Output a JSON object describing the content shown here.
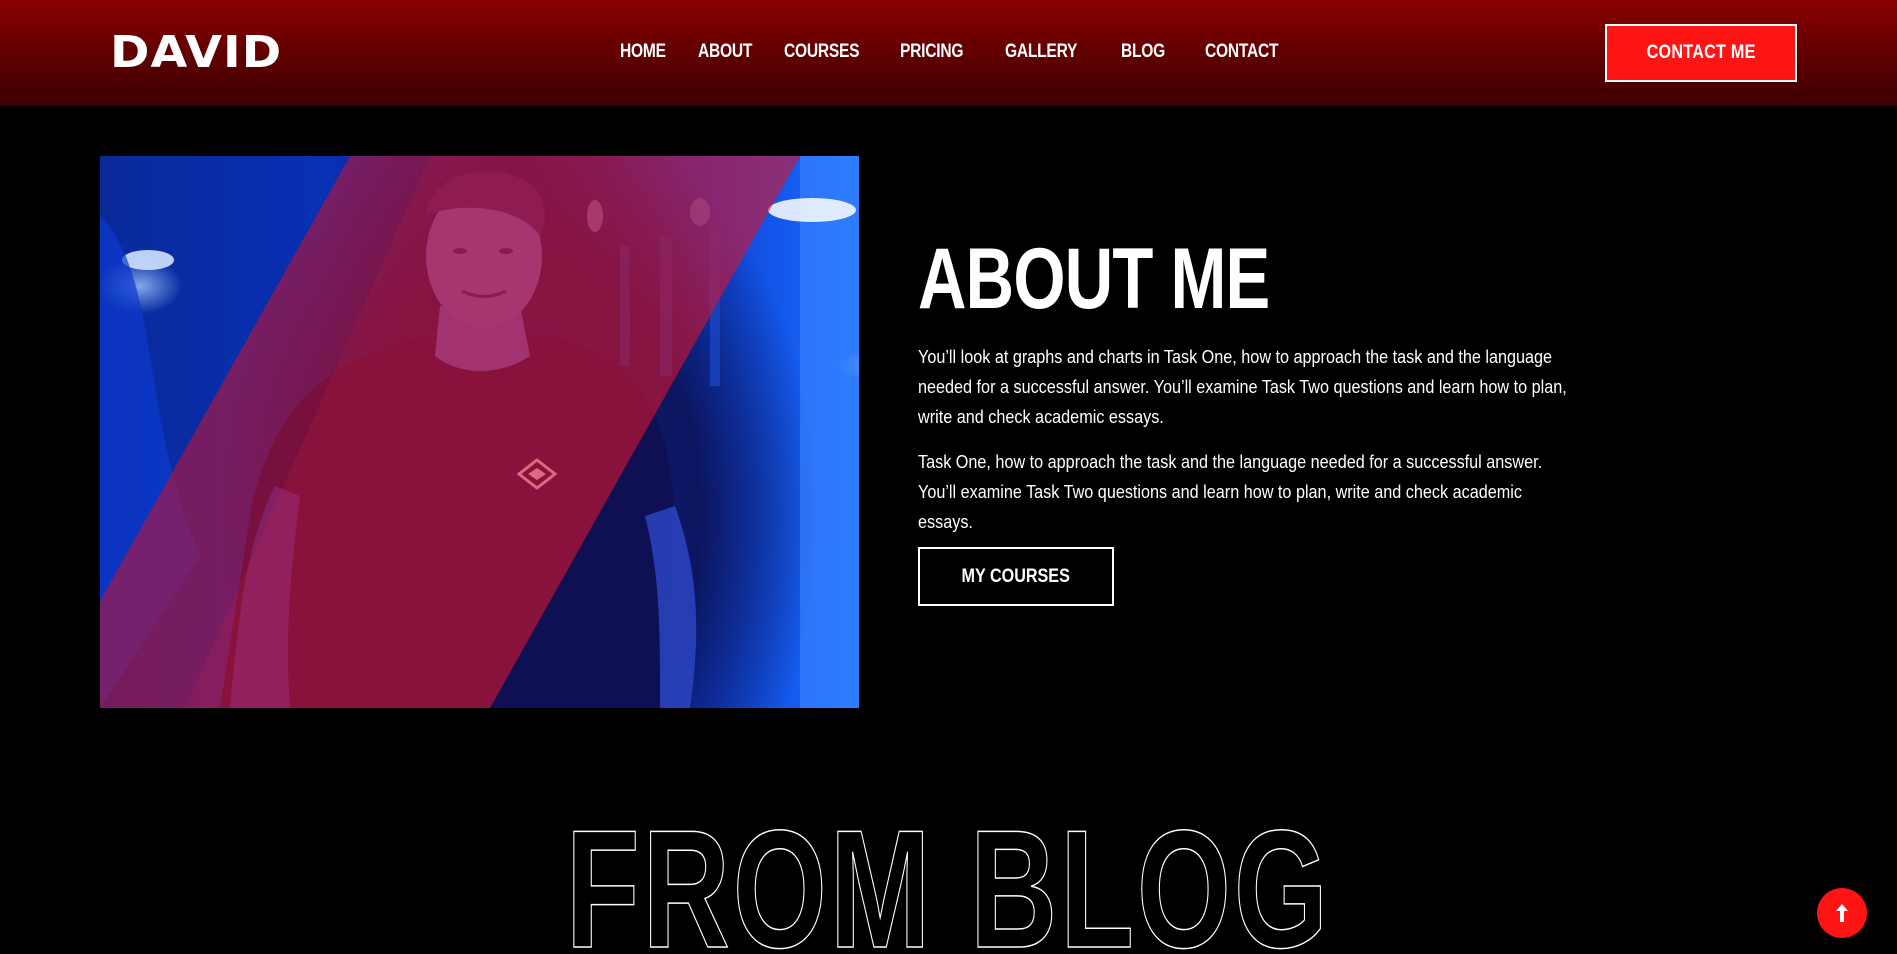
{
  "brand": {
    "logo_text": "DAVID"
  },
  "nav": {
    "items": [
      "HOME",
      "ABOUT",
      "COURSES",
      "PRICING",
      "GALLERY",
      "BLOG",
      "CONTACT"
    ]
  },
  "header": {
    "contact_label": "CONTACT ME"
  },
  "about": {
    "title": "ABOUT ME",
    "paragraph_1": "You’ll look at graphs and charts in Task One, how to approach the task and the language needed for a successful answer. You’ll examine Task Two questions and learn how to plan, write and check academic essays.",
    "paragraph_2": "Task One, how to approach the task and the language needed for a successful answer. You’ll examine Task Two questions and learn how to plan, write and check academic essays.",
    "button_label": "MY COURSES"
  },
  "blog": {
    "title": "FROM BLOG"
  },
  "icons": {
    "photo": "trainer-portrait-image",
    "scroll_top": "arrow-up-icon"
  },
  "colors": {
    "accent": "#ff1414",
    "header_top": "#8a0000",
    "background": "#000000"
  }
}
